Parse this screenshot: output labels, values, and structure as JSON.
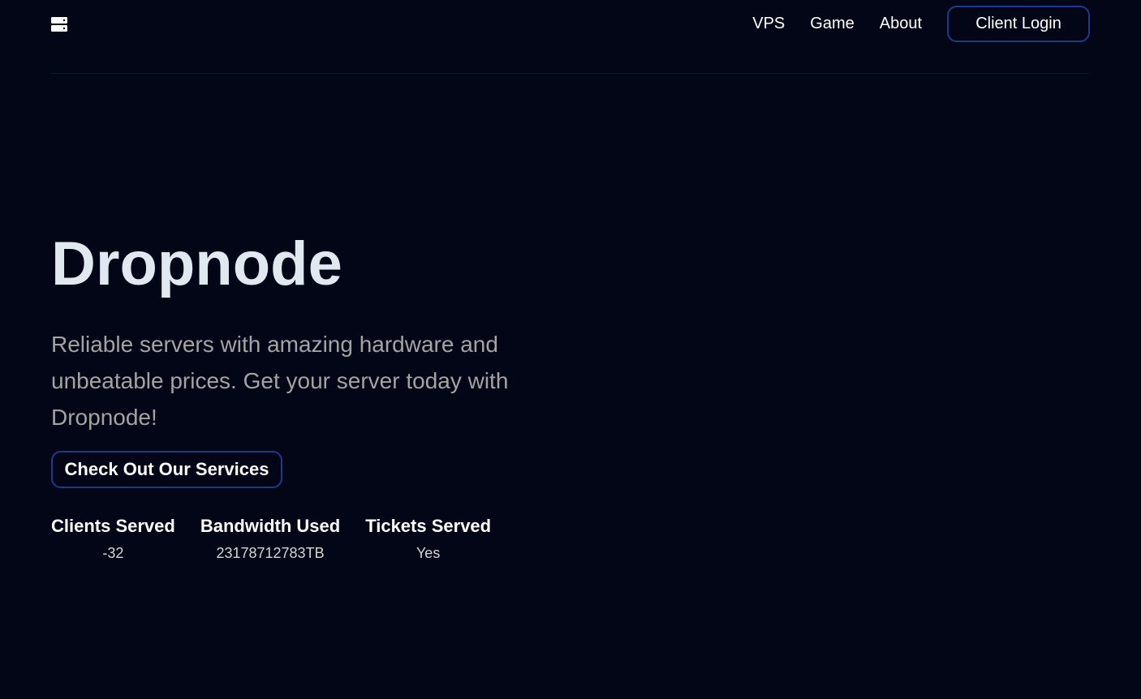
{
  "nav": {
    "logo_icon": "server-icon",
    "links": [
      "VPS",
      "Game",
      "About"
    ],
    "login_label": "Client Login"
  },
  "hero": {
    "title": "Dropnode",
    "description": "Reliable servers with amazing hardware and unbeatable prices. Get your server today with Dropnode!",
    "cta_label": "Check Out Our Services"
  },
  "stats": [
    {
      "label": "Clients Served",
      "value": "-32"
    },
    {
      "label": "Bandwidth Used",
      "value": "23178712783TB"
    },
    {
      "label": "Tickets Served",
      "value": "Yes"
    }
  ],
  "colors": {
    "background": "#020617",
    "accent_border": "#1e3a8a",
    "title": "#e2e8f0",
    "muted_text": "#a3a3a3"
  }
}
